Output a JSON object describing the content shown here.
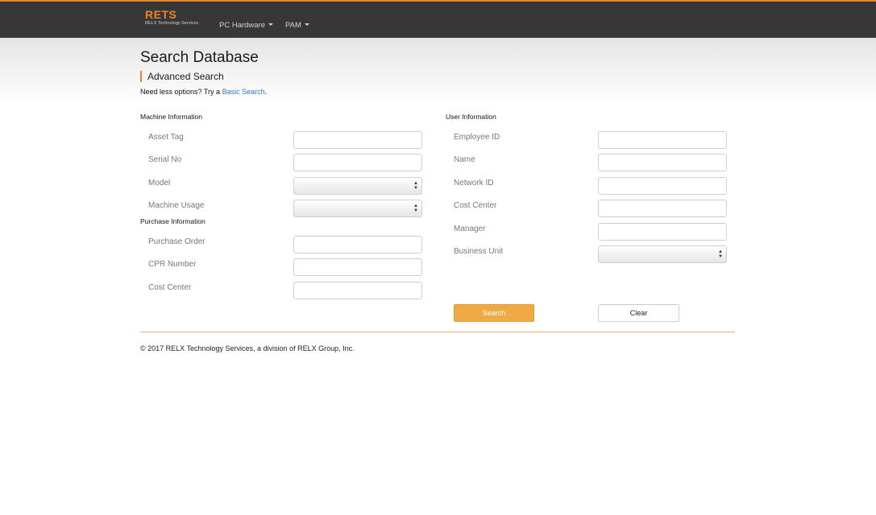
{
  "nav": {
    "brand": "RETS",
    "brand_sub": "RELX Technology Services",
    "items": [
      {
        "label": "PC Hardware"
      },
      {
        "label": "PAM"
      }
    ]
  },
  "page": {
    "title": "Search Database",
    "subtitle": "Advanced Search",
    "hint_prefix": "Need less options? Try a ",
    "hint_link": "Basic Search",
    "hint_suffix": "."
  },
  "sections": {
    "machine": "Machine Information",
    "purchase": "Purchase Information",
    "user": "User Information"
  },
  "fields": {
    "asset_tag": "Asset Tag",
    "serial_no": "Serial No",
    "model": "Model",
    "machine_usage": "Machine Usage",
    "purchase_order": "Purchase Order",
    "cpr_number": "CPR Number",
    "purchase_cost_center": "Cost Center",
    "employee_id": "Employee ID",
    "name": "Name",
    "network_id": "Network ID",
    "user_cost_center": "Cost Center",
    "manager": "Manager",
    "business_unit": "Business Unit"
  },
  "buttons": {
    "search": "Search",
    "clear": "Clear"
  },
  "footer": "© 2017 RELX Technology Services, a division of RELX Group, Inc.",
  "colors": {
    "accent": "#e8872a",
    "search_button": "#efaa45",
    "navbar": "#373737",
    "link": "#2f7bbf"
  }
}
